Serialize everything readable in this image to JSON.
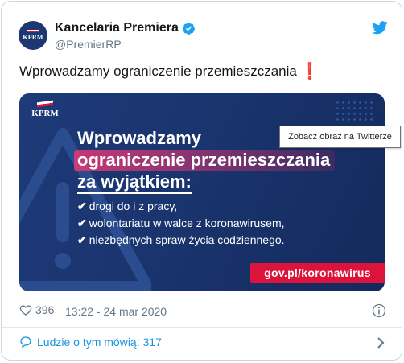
{
  "account": {
    "name": "Kancelaria Premiera",
    "handle": "@PremierRP",
    "avatar_text": "KPRM"
  },
  "tweet": {
    "text": "Wprowadzamy ograniczenie przemieszczania",
    "emoji": "❗"
  },
  "media": {
    "logo_text": "KPRM",
    "headline_line1": "Wprowadzamy",
    "headline_line2": "ograniczenie przemieszczania",
    "headline_line3": "za wyjątkiem:",
    "bullets": [
      "drogi do i z pracy,",
      "wolontariatu w walce z koronawirusem,",
      "niezbędnych spraw życia codziennego."
    ],
    "check_mark": "✔",
    "gov_link": "gov.pl/koronawirus",
    "tooltip": "Zobacz obraz na Twitterze"
  },
  "footer": {
    "likes": "396",
    "timestamp": "13:22 - 24 mar 2020",
    "people_talking": "Ludzie o tym mówią: 317"
  },
  "colors": {
    "accent": "#1b95e0",
    "brand_navy": "#1c3771",
    "gov_red": "#dc143c",
    "highlight_pink": "#e43975"
  },
  "icons": [
    "verified-badge-icon",
    "twitter-bird-icon",
    "heart-icon",
    "info-icon",
    "speech-bubble-icon",
    "chevron-right-icon",
    "warning-triangle-icon"
  ]
}
